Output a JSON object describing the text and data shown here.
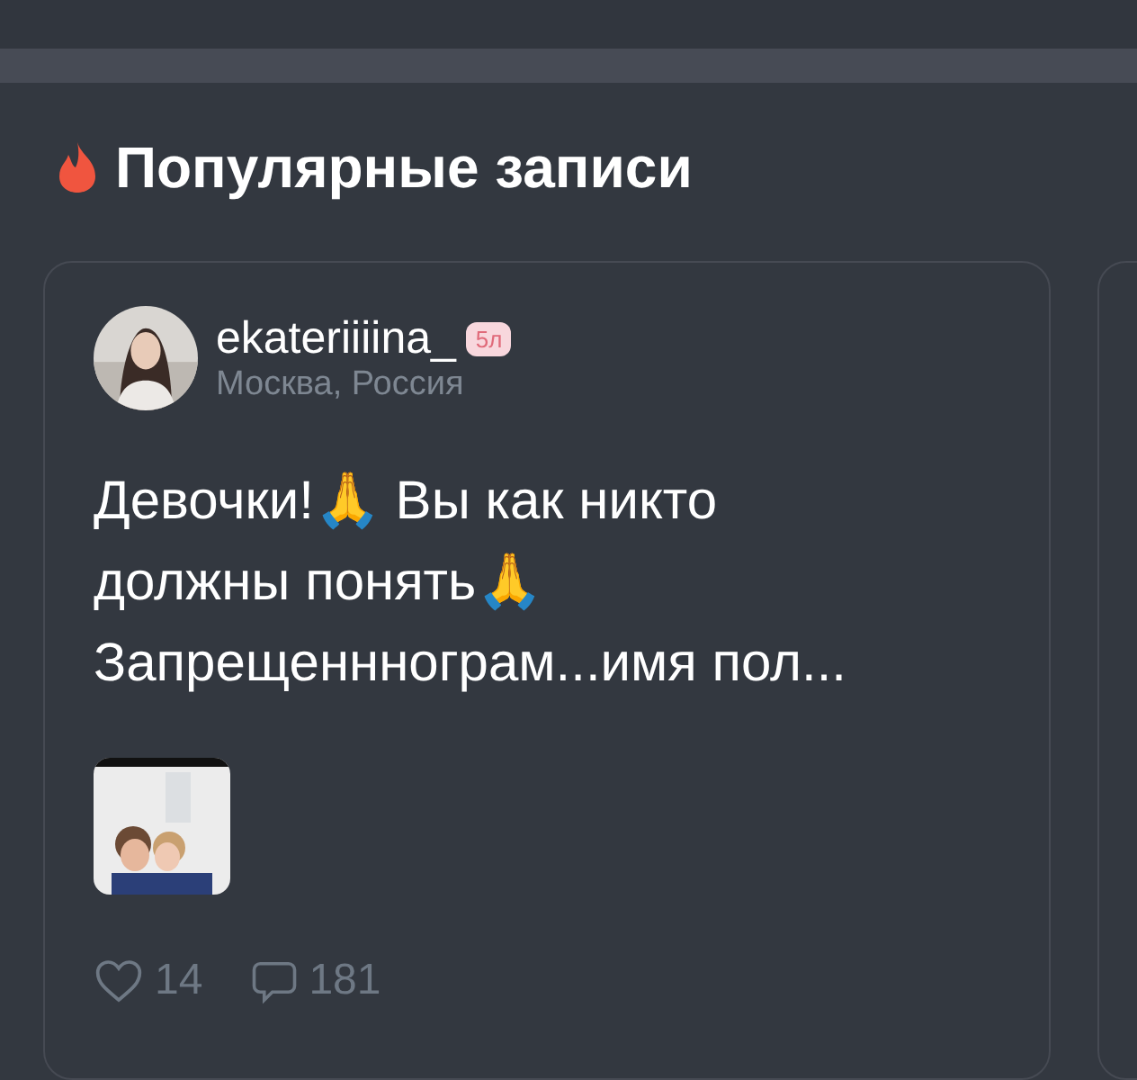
{
  "section": {
    "title": "Популярные записи"
  },
  "post": {
    "author": "ekateriiiina_",
    "badge": "5л",
    "location": "Москва, Россия",
    "text": "Девочки!🙏 Вы как никто должны понять🙏 Запрещенннограм...имя пол...",
    "likes": "14",
    "comments": "181"
  }
}
